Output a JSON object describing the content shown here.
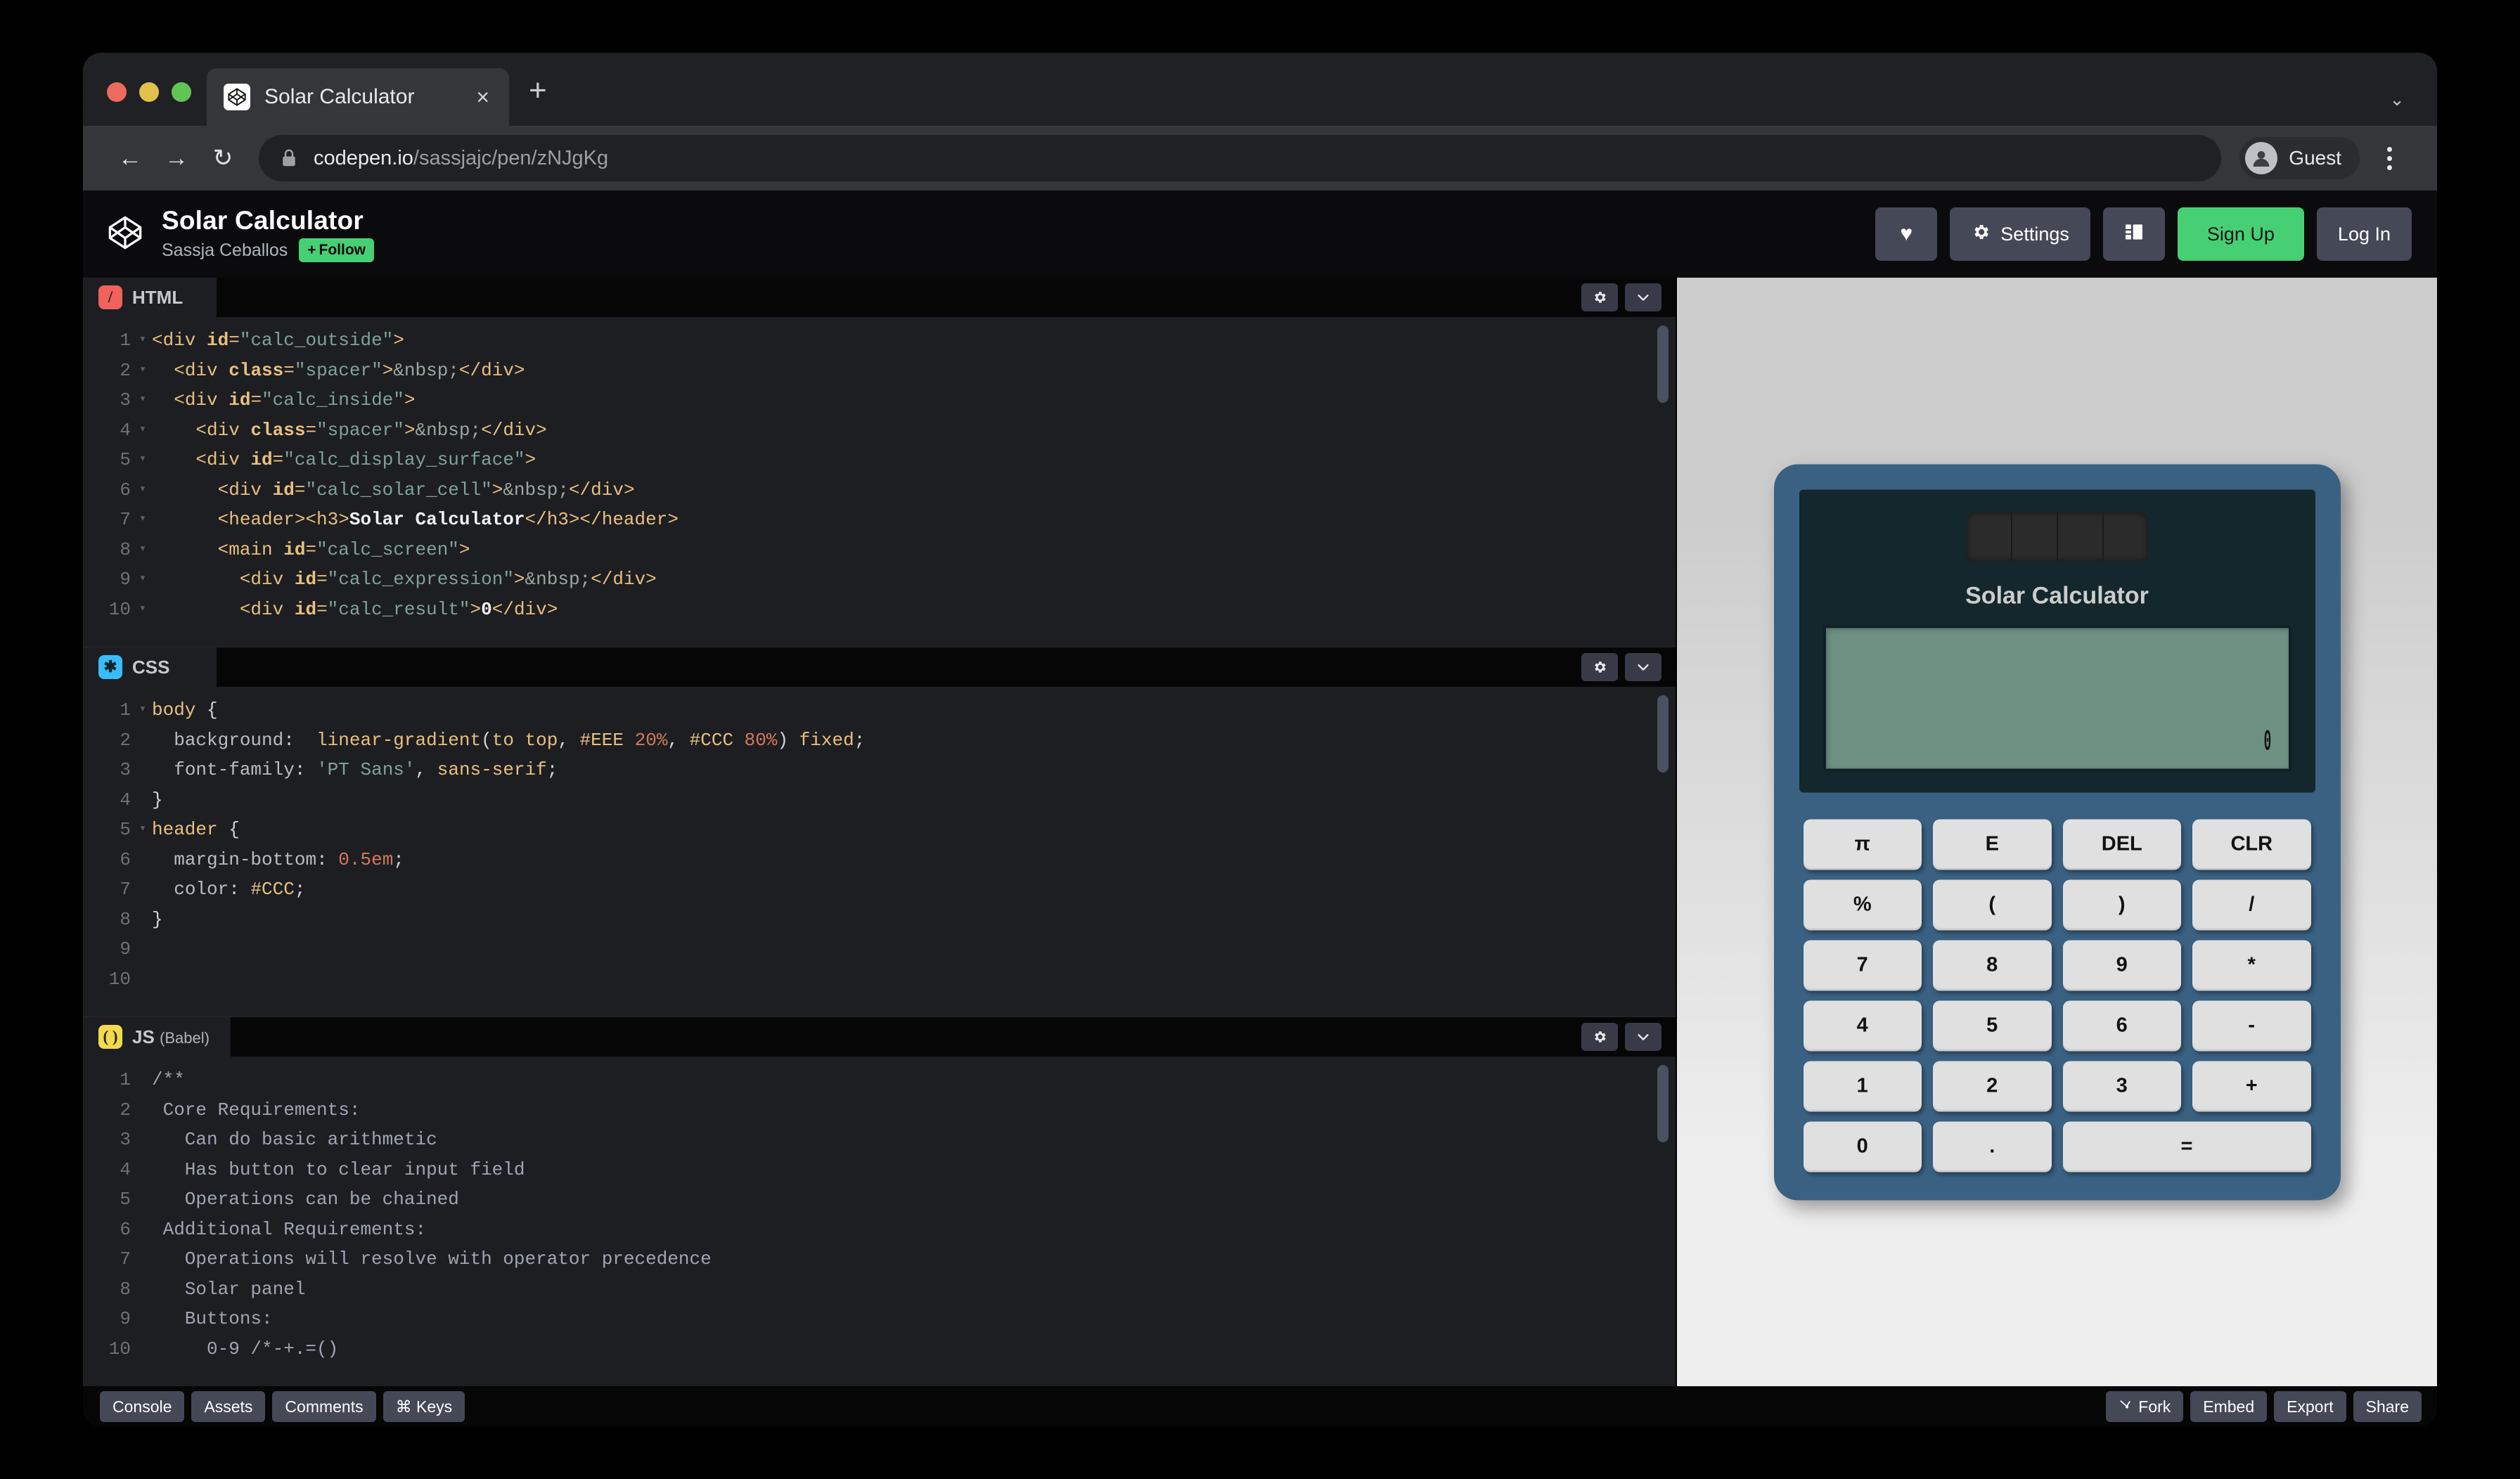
{
  "browser": {
    "tab": {
      "title": "Solar Calculator",
      "favicon": "codepen-logo-icon",
      "close": "×"
    },
    "new_tab": "+",
    "nav": {
      "back": "←",
      "forward": "→",
      "reload": "↻"
    },
    "omnibox": {
      "lock": "lock-icon",
      "url_host": "codepen.io",
      "url_path": "/sassjajc/pen/zNJgKg"
    },
    "profile": {
      "name": "Guest"
    },
    "tabstrip_chevron": "⌄"
  },
  "pen_header": {
    "title": "Solar Calculator",
    "author": "Sassja Ceballos",
    "follow_label": "Follow",
    "follow_plus": "+",
    "actions": {
      "love_label": "♥",
      "settings_label": "Settings",
      "layout_label": "",
      "signup_label": "Sign Up",
      "login_label": "Log In"
    }
  },
  "editors": [
    {
      "lang": "HTML",
      "badge": "/",
      "badge_class": "html",
      "sub": "",
      "gear_icon": "gear-icon",
      "chevron_icon": "chevron-down-icon",
      "lines": [
        {
          "n": "1",
          "fold": "▾",
          "html": "<span class=\"t-tag\">&lt;div </span><span class=\"t-attr\">id</span><span class=\"t-tag\">=</span><span class=\"t-str\">\"calc_outside\"</span><span class=\"t-tag\">&gt;</span>"
        },
        {
          "n": "2",
          "fold": "▾",
          "html": "  <span class=\"t-tag\">&lt;div </span><span class=\"t-attr\">class</span><span class=\"t-tag\">=</span><span class=\"t-str\">\"spacer\"</span><span class=\"t-tag\">&gt;</span><span class=\"t-ent\">&amp;nbsp;</span><span class=\"t-tag\">&lt;/div&gt;</span>"
        },
        {
          "n": "3",
          "fold": "▾",
          "html": "  <span class=\"t-tag\">&lt;div </span><span class=\"t-attr\">id</span><span class=\"t-tag\">=</span><span class=\"t-str\">\"calc_inside\"</span><span class=\"t-tag\">&gt;</span>"
        },
        {
          "n": "4",
          "fold": "▾",
          "html": "    <span class=\"t-tag\">&lt;div </span><span class=\"t-attr\">class</span><span class=\"t-tag\">=</span><span class=\"t-str\">\"spacer\"</span><span class=\"t-tag\">&gt;</span><span class=\"t-ent\">&amp;nbsp;</span><span class=\"t-tag\">&lt;/div&gt;</span>"
        },
        {
          "n": "5",
          "fold": "▾",
          "html": "    <span class=\"t-tag\">&lt;div </span><span class=\"t-attr\">id</span><span class=\"t-tag\">=</span><span class=\"t-str\">\"calc_display_surface\"</span><span class=\"t-tag\">&gt;</span>"
        },
        {
          "n": "6",
          "fold": "▾",
          "html": "      <span class=\"t-tag\">&lt;div </span><span class=\"t-attr\">id</span><span class=\"t-tag\">=</span><span class=\"t-str\">\"calc_solar_cell\"</span><span class=\"t-tag\">&gt;</span><span class=\"t-ent\">&amp;nbsp;</span><span class=\"t-tag\">&lt;/div&gt;</span>"
        },
        {
          "n": "7",
          "fold": "▾",
          "html": "      <span class=\"t-tag\">&lt;header&gt;&lt;h3&gt;</span><span class=\"t-txt\">Solar Calculator</span><span class=\"t-tag\">&lt;/h3&gt;&lt;/header&gt;</span>"
        },
        {
          "n": "8",
          "fold": "▾",
          "html": "      <span class=\"t-tag\">&lt;main </span><span class=\"t-attr\">id</span><span class=\"t-tag\">=</span><span class=\"t-str\">\"calc_screen\"</span><span class=\"t-tag\">&gt;</span>"
        },
        {
          "n": "9",
          "fold": "▾",
          "html": "        <span class=\"t-tag\">&lt;div </span><span class=\"t-attr\">id</span><span class=\"t-tag\">=</span><span class=\"t-str\">\"calc_expression\"</span><span class=\"t-tag\">&gt;</span><span class=\"t-ent\">&amp;nbsp;</span><span class=\"t-tag\">&lt;/div&gt;</span>"
        },
        {
          "n": "10",
          "fold": "▾",
          "html": "        <span class=\"t-tag\">&lt;div </span><span class=\"t-attr\">id</span><span class=\"t-tag\">=</span><span class=\"t-str\">\"calc_result\"</span><span class=\"t-tag\">&gt;</span><span class=\"t-txt\">0</span><span class=\"t-tag\">&lt;/div&gt;</span>"
        }
      ]
    },
    {
      "lang": "CSS",
      "badge": "✱",
      "badge_class": "css",
      "sub": "",
      "gear_icon": "gear-icon",
      "chevron_icon": "chevron-down-icon",
      "lines": [
        {
          "n": "1",
          "fold": "▾",
          "html": "<span class=\"t-sel\">body</span> <span class=\"code-text\">{</span>"
        },
        {
          "n": "2",
          "fold": "",
          "html": "  <span class=\"t-prop\">background</span><span class=\"code-text\">:</span>  <span class=\"t-val\">linear-gradient</span><span class=\"code-text\">(</span><span class=\"t-val\">to top</span><span class=\"code-text\">, </span><span class=\"t-val\">#EEE</span> <span class=\"t-num\">20%</span><span class=\"code-text\">, </span><span class=\"t-val\">#CCC</span> <span class=\"t-num\">80%</span><span class=\"code-text\">) </span><span class=\"t-val\">fixed</span><span class=\"code-text\">;</span>"
        },
        {
          "n": "3",
          "fold": "",
          "html": "  <span class=\"t-prop\">font-family</span><span class=\"code-text\">: </span><span class=\"t-strq\">'PT Sans'</span><span class=\"code-text\">, </span><span class=\"t-val\">sans-serif</span><span class=\"code-text\">;</span>"
        },
        {
          "n": "4",
          "fold": "",
          "html": "<span class=\"code-text\">}</span>"
        },
        {
          "n": "5",
          "fold": "▾",
          "html": "<span class=\"t-sel\">header</span> <span class=\"code-text\">{</span>"
        },
        {
          "n": "6",
          "fold": "",
          "html": "  <span class=\"t-prop\">margin-bottom</span><span class=\"code-text\">: </span><span class=\"t-num\">0.5em</span><span class=\"code-text\">;</span>"
        },
        {
          "n": "7",
          "fold": "",
          "html": "  <span class=\"t-prop\">color</span><span class=\"code-text\">: </span><span class=\"t-val\">#CCC</span><span class=\"code-text\">;</span>"
        },
        {
          "n": "8",
          "fold": "",
          "html": "<span class=\"code-text\">}</span>"
        },
        {
          "n": "9",
          "fold": "",
          "html": ""
        },
        {
          "n": "10",
          "fold": "",
          "html": ""
        }
      ]
    },
    {
      "lang": "JS",
      "badge": "( )",
      "badge_class": "js",
      "sub": "(Babel)",
      "gear_icon": "gear-icon",
      "chevron_icon": "chevron-down-icon",
      "lines": [
        {
          "n": "1",
          "fold": "",
          "html": "<span class=\"t-com\">/**</span>"
        },
        {
          "n": "2",
          "fold": "",
          "html": "<span class=\"t-com\"> Core Requirements:</span>"
        },
        {
          "n": "3",
          "fold": "",
          "html": "<span class=\"t-com\">   Can do basic arithmetic</span>"
        },
        {
          "n": "4",
          "fold": "",
          "html": "<span class=\"t-com\">   Has button to clear input field</span>"
        },
        {
          "n": "5",
          "fold": "",
          "html": "<span class=\"t-com\">   Operations can be chained</span>"
        },
        {
          "n": "6",
          "fold": "",
          "html": "<span class=\"t-com\"> Additional Requirements:</span>"
        },
        {
          "n": "7",
          "fold": "",
          "html": "<span class=\"t-com\">   Operations will resolve with operator precedence</span>"
        },
        {
          "n": "8",
          "fold": "",
          "html": "<span class=\"t-com\">   Solar panel</span>"
        },
        {
          "n": "9",
          "fold": "",
          "html": "<span class=\"t-com\">   Buttons:</span>"
        },
        {
          "n": "10",
          "fold": "",
          "html": "<span class=\"t-com\">     0-9 /*-+.=()</span>"
        }
      ]
    }
  ],
  "preview": {
    "calc_title": "Solar Calculator",
    "calc_expression": " ",
    "calc_result": "0",
    "solar_cells": 4,
    "buttons": [
      "π",
      "E",
      "DEL",
      "CLR",
      "%",
      "(",
      ")",
      "/",
      "7",
      "8",
      "9",
      "*",
      "4",
      "5",
      "6",
      "-",
      "1",
      "2",
      "3",
      "+",
      "0",
      ".",
      "="
    ],
    "colors": {
      "case": "#3A6182",
      "display_surface": "#13272C",
      "lcd": "#6F9184",
      "key": "#E0E0E0"
    }
  },
  "bottom_bar": {
    "left": [
      "Console",
      "Assets",
      "Comments",
      "⌘ Keys"
    ],
    "right": [
      "Fork",
      "Embed",
      "Export",
      "Share"
    ],
    "fork_icon": "fork-icon"
  }
}
